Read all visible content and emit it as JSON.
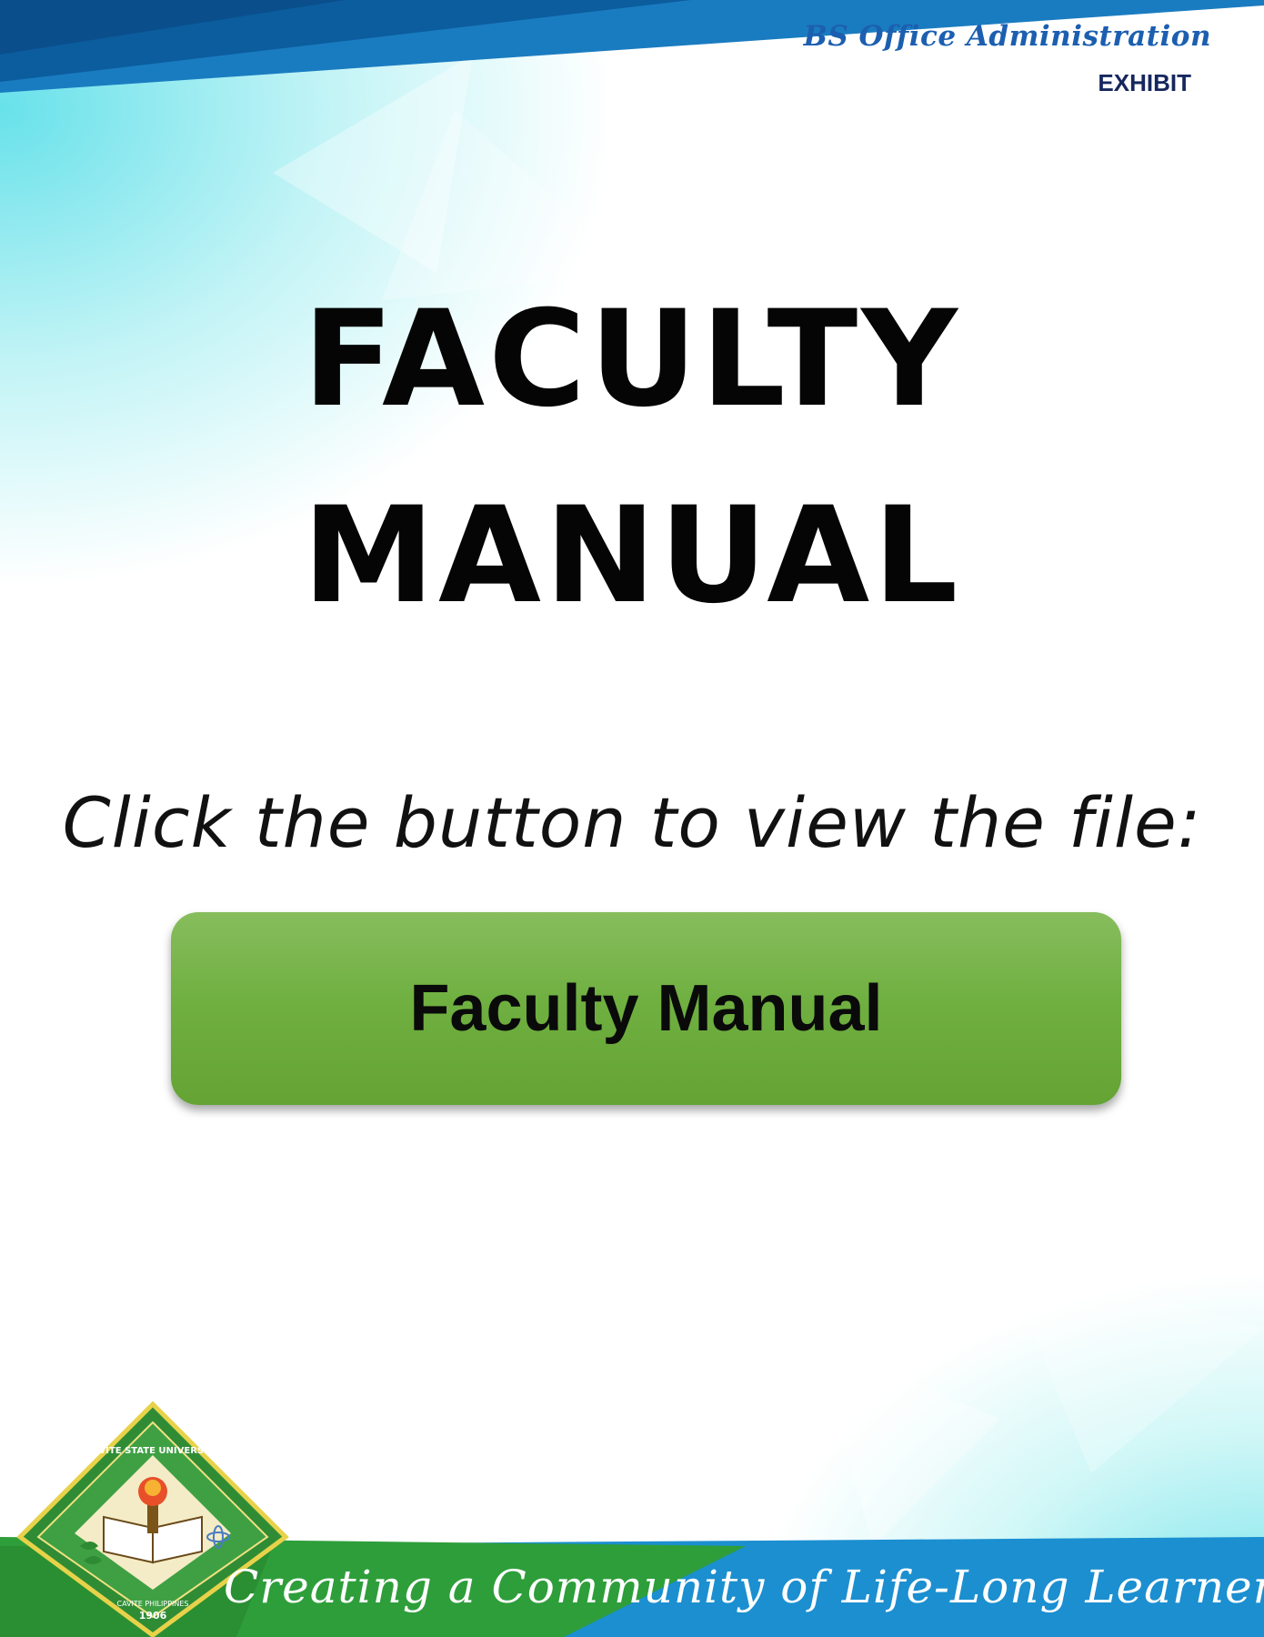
{
  "header": {
    "brand": "BS Office Administration",
    "label": "EXHIBIT"
  },
  "title": {
    "line1": "FACULTY",
    "line2": "MANUAL"
  },
  "instruction": "Click the button to view the file:",
  "button": {
    "label": "Faculty Manual"
  },
  "footer": {
    "seal_text_top": "CAVITE STATE UNIVERSITY",
    "seal_text_bottom": "CAVITE PHILIPPINES",
    "seal_year": "1906",
    "motto": "Creating a Community of Life-Long Learners"
  },
  "colors": {
    "top_band": "#0b6aaa",
    "bottom_band": "#1a8fd0",
    "green_band": "#2e9e3a",
    "button_green": "#70b041",
    "brand_blue": "#1c5fb0",
    "cyan_accent": "#4ddce6"
  }
}
